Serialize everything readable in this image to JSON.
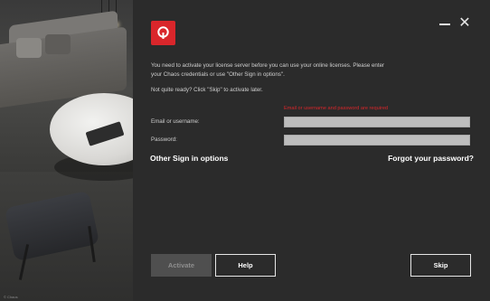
{
  "window": {
    "close_glyph": "✕"
  },
  "hero": {
    "caption": "© Chaos"
  },
  "message": {
    "line1": "You need to activate your license server before you can use your online licenses. Please enter your Chaos credentials or use \"Other Sign in options\".",
    "later": "Not quite ready? Click \"Skip\" to activate later."
  },
  "form": {
    "error": "Email or username and password are required",
    "email_label": "Email or username:",
    "email_value": "",
    "password_label": "Password:",
    "password_value": ""
  },
  "links": {
    "other_sign_in": "Other Sign in options",
    "forgot_password": "Forgot your password?"
  },
  "buttons": {
    "activate": "Activate",
    "help": "Help",
    "skip": "Skip"
  },
  "colors": {
    "accent": "#d9262b",
    "panel_bg": "#2b2b2b",
    "input_bg": "#bdbdbd"
  },
  "icons": [
    "chaos-logo-icon",
    "minimize-icon",
    "close-icon"
  ]
}
